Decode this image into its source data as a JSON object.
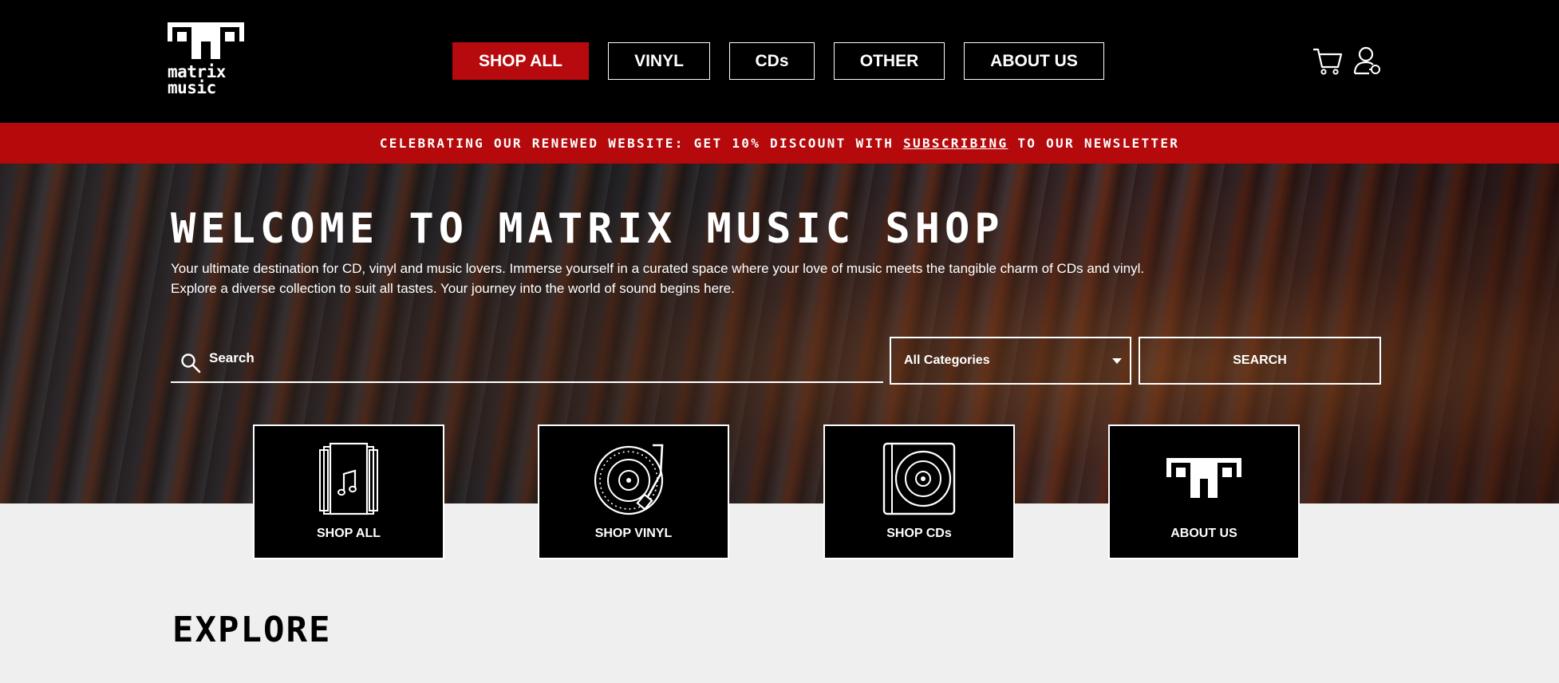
{
  "brand": {
    "logo_text_line1": "matrix",
    "logo_text_line2": "music"
  },
  "nav": {
    "items": [
      {
        "label": "SHOP ALL",
        "active": true
      },
      {
        "label": "VINYL",
        "active": false
      },
      {
        "label": "CDs",
        "active": false
      },
      {
        "label": "OTHER",
        "active": false
      },
      {
        "label": "ABOUT US",
        "active": false
      }
    ]
  },
  "header_icons": [
    "cart-icon",
    "user-icon"
  ],
  "banner": {
    "prefix": "CELEBRATING OUR RENEWED WEBSITE: GET 10% DISCOUNT WITH ",
    "link": "SUBSCRIBING",
    "suffix": " TO OUR NEWSLETTER"
  },
  "hero": {
    "title": "WELCOME TO MATRIX MUSIC SHOP",
    "text_line1": "Your ultimate destination for CD, vinyl and music lovers. Immerse yourself in a curated space where your love of music meets the tangible charm of CDs and vinyl.",
    "text_line2": "Explore a diverse collection to suit all tastes. Your journey into the world of sound begins here."
  },
  "search": {
    "placeholder": "Search",
    "category_selected": "All Categories",
    "button_label": "SEARCH"
  },
  "tiles": [
    {
      "label": "SHOP ALL",
      "icon": "albums-icon"
    },
    {
      "label": "SHOP VINYL",
      "icon": "turntable-icon"
    },
    {
      "label": "SHOP CDs",
      "icon": "cd-icon"
    },
    {
      "label": "ABOUT US",
      "icon": "matrix-logo-icon"
    }
  ],
  "section": {
    "explore_title": "EXPLORE"
  },
  "colors": {
    "accent_red": "#b5090b",
    "header_bg": "#000000",
    "page_bg": "#efefef"
  }
}
